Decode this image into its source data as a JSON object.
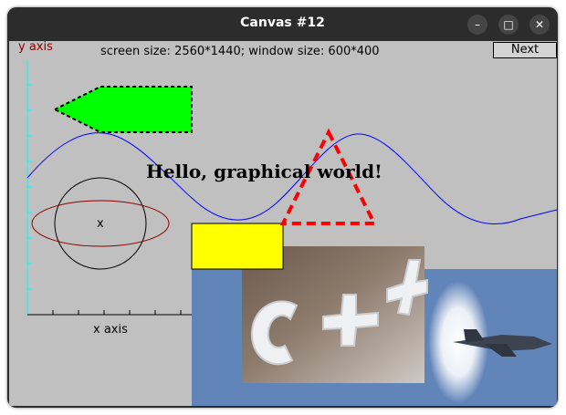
{
  "window": {
    "title": "Canvas #12",
    "minimize_icon": "minimize-icon",
    "maximize_icon": "maximize-icon",
    "close_icon": "close-icon"
  },
  "canvas": {
    "info_text": "screen size: 2560*1440; window size: 600*400",
    "next_label": "Next",
    "y_axis_label": "y axis",
    "x_axis_label": "x axis",
    "circle_marker": "x",
    "hello_text": "Hello, graphical world!",
    "photo_cpp": "snow sculpture spelling C++",
    "photo_jet": "fighter jet with vapor cone over blue sky"
  },
  "colors": {
    "canvas_bg": "#c0c0c0",
    "axis": "#00ffff",
    "y_axis_label": "#8b0000",
    "sine": "#0000ff",
    "arrow_fill": "#00ff00",
    "triangle": "#ff0000",
    "rect_fill": "#ffff00",
    "ellipse": "#8b0000",
    "sky": "#5a7fb5"
  }
}
